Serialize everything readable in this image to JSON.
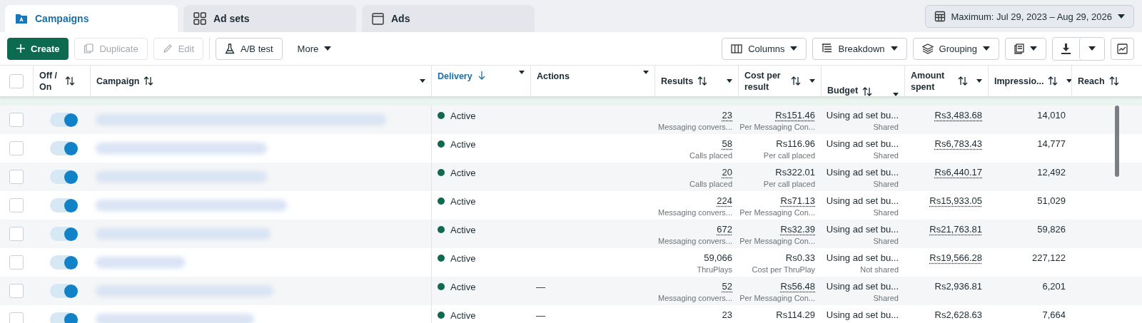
{
  "tabs": [
    {
      "label": "Campaigns",
      "selected": true
    },
    {
      "label": "Ad sets",
      "selected": false
    },
    {
      "label": "Ads",
      "selected": false
    }
  ],
  "date_range": "Maximum: Jul 29, 2023 – Aug 29, 2026",
  "toolbar_left": [
    {
      "label": "Create",
      "kind": "primary",
      "disabled": false
    },
    {
      "label": "Duplicate",
      "kind": "plain",
      "disabled": true
    },
    {
      "label": "Edit",
      "kind": "plain",
      "disabled": true
    },
    {
      "label": "A/B test",
      "kind": "plain",
      "disabled": false
    },
    {
      "label": "More",
      "kind": "menu",
      "disabled": false
    }
  ],
  "toolbar_right": [
    {
      "label": "Columns"
    },
    {
      "label": "Breakdown"
    },
    {
      "label": "Grouping"
    }
  ],
  "select_all": {
    "checked": false
  },
  "columns": [
    {
      "label": "Off / On",
      "kind": "sortable",
      "selected": false
    },
    {
      "label": "Campaign",
      "kind": "sortable",
      "selected": false
    },
    {
      "label": "Delivery",
      "kind": "sorted",
      "selected": true
    },
    {
      "label": "Actions",
      "kind": "plain",
      "selected": false
    },
    {
      "label": "Results",
      "kind": "sortable",
      "selected": false
    },
    {
      "label": "Cost per result",
      "kind": "sortable",
      "selected": false
    },
    {
      "label": "Budget",
      "kind": "sortable",
      "selected": false
    },
    {
      "label": "Amount spent",
      "kind": "sortable",
      "selected": false
    },
    {
      "label": "Impressio...",
      "kind": "sortable",
      "selected": false
    },
    {
      "label": "Reach",
      "kind": "sortable",
      "selected": false
    }
  ],
  "rows": [
    {
      "checked": false,
      "on": true,
      "delivery": "Active",
      "actions": "",
      "results": {
        "value": "23",
        "sub": "Messaging convers...",
        "dotted": true
      },
      "cost": {
        "value": "Rs151.46",
        "sub": "Per Messaging Con...",
        "dotted": true
      },
      "budget": {
        "value": "Using ad set bu...",
        "sub": "Shared"
      },
      "spent": {
        "value": "Rs3,483.68",
        "dotted": true
      },
      "impressions": "14,010"
    },
    {
      "checked": false,
      "on": true,
      "delivery": "Active",
      "actions": "",
      "results": {
        "value": "58",
        "sub": "Calls placed",
        "dotted": true
      },
      "cost": {
        "value": "Rs116.96",
        "sub": "Per call placed",
        "dotted": false
      },
      "budget": {
        "value": "Using ad set bu...",
        "sub": "Shared"
      },
      "spent": {
        "value": "Rs6,783.43",
        "dotted": true
      },
      "impressions": "14,777"
    },
    {
      "checked": false,
      "on": true,
      "delivery": "Active",
      "actions": "",
      "results": {
        "value": "20",
        "sub": "Calls placed",
        "dotted": true
      },
      "cost": {
        "value": "Rs322.01",
        "sub": "Per call placed",
        "dotted": false
      },
      "budget": {
        "value": "Using ad set bu...",
        "sub": "Shared"
      },
      "spent": {
        "value": "Rs6,440.17",
        "dotted": true
      },
      "impressions": "12,492"
    },
    {
      "checked": false,
      "on": true,
      "delivery": "Active",
      "actions": "",
      "results": {
        "value": "224",
        "sub": "Messaging convers...",
        "dotted": true
      },
      "cost": {
        "value": "Rs71.13",
        "sub": "Per Messaging Con...",
        "dotted": true
      },
      "budget": {
        "value": "Using ad set bu...",
        "sub": "Shared"
      },
      "spent": {
        "value": "Rs15,933.05",
        "dotted": true
      },
      "impressions": "51,029"
    },
    {
      "checked": false,
      "on": true,
      "delivery": "Active",
      "actions": "",
      "results": {
        "value": "672",
        "sub": "Messaging convers...",
        "dotted": true
      },
      "cost": {
        "value": "Rs32.39",
        "sub": "Per Messaging Con...",
        "dotted": true
      },
      "budget": {
        "value": "Using ad set bu...",
        "sub": "Shared"
      },
      "spent": {
        "value": "Rs21,763.81",
        "dotted": true
      },
      "impressions": "59,826"
    },
    {
      "checked": false,
      "on": true,
      "delivery": "Active",
      "actions": "",
      "results": {
        "value": "59,066",
        "sub": "ThruPlays",
        "dotted": false
      },
      "cost": {
        "value": "Rs0.33",
        "sub": "Cost per ThruPlay",
        "dotted": false
      },
      "budget": {
        "value": "Using ad set bu...",
        "sub": "Not shared"
      },
      "spent": {
        "value": "Rs19,566.28",
        "dotted": true
      },
      "impressions": "227,122"
    },
    {
      "checked": false,
      "on": true,
      "delivery": "Active",
      "actions": "—",
      "results": {
        "value": "52",
        "sub": "Messaging convers...",
        "dotted": true
      },
      "cost": {
        "value": "Rs56.48",
        "sub": "Per Messaging Con...",
        "dotted": true
      },
      "budget": {
        "value": "Using ad set bu...",
        "sub": "Shared"
      },
      "spent": {
        "value": "Rs2,936.81",
        "dotted": false
      },
      "impressions": "6,201"
    },
    {
      "checked": false,
      "on": true,
      "delivery": "Active",
      "actions": "—",
      "results": {
        "value": "23",
        "dotted": false
      },
      "cost": {
        "value": "Rs114.29",
        "dotted": false
      },
      "budget": {
        "value": "Using ad set bu..."
      },
      "spent": {
        "value": "Rs2,628.63",
        "dotted": false
      },
      "impressions": "7,664"
    }
  ]
}
